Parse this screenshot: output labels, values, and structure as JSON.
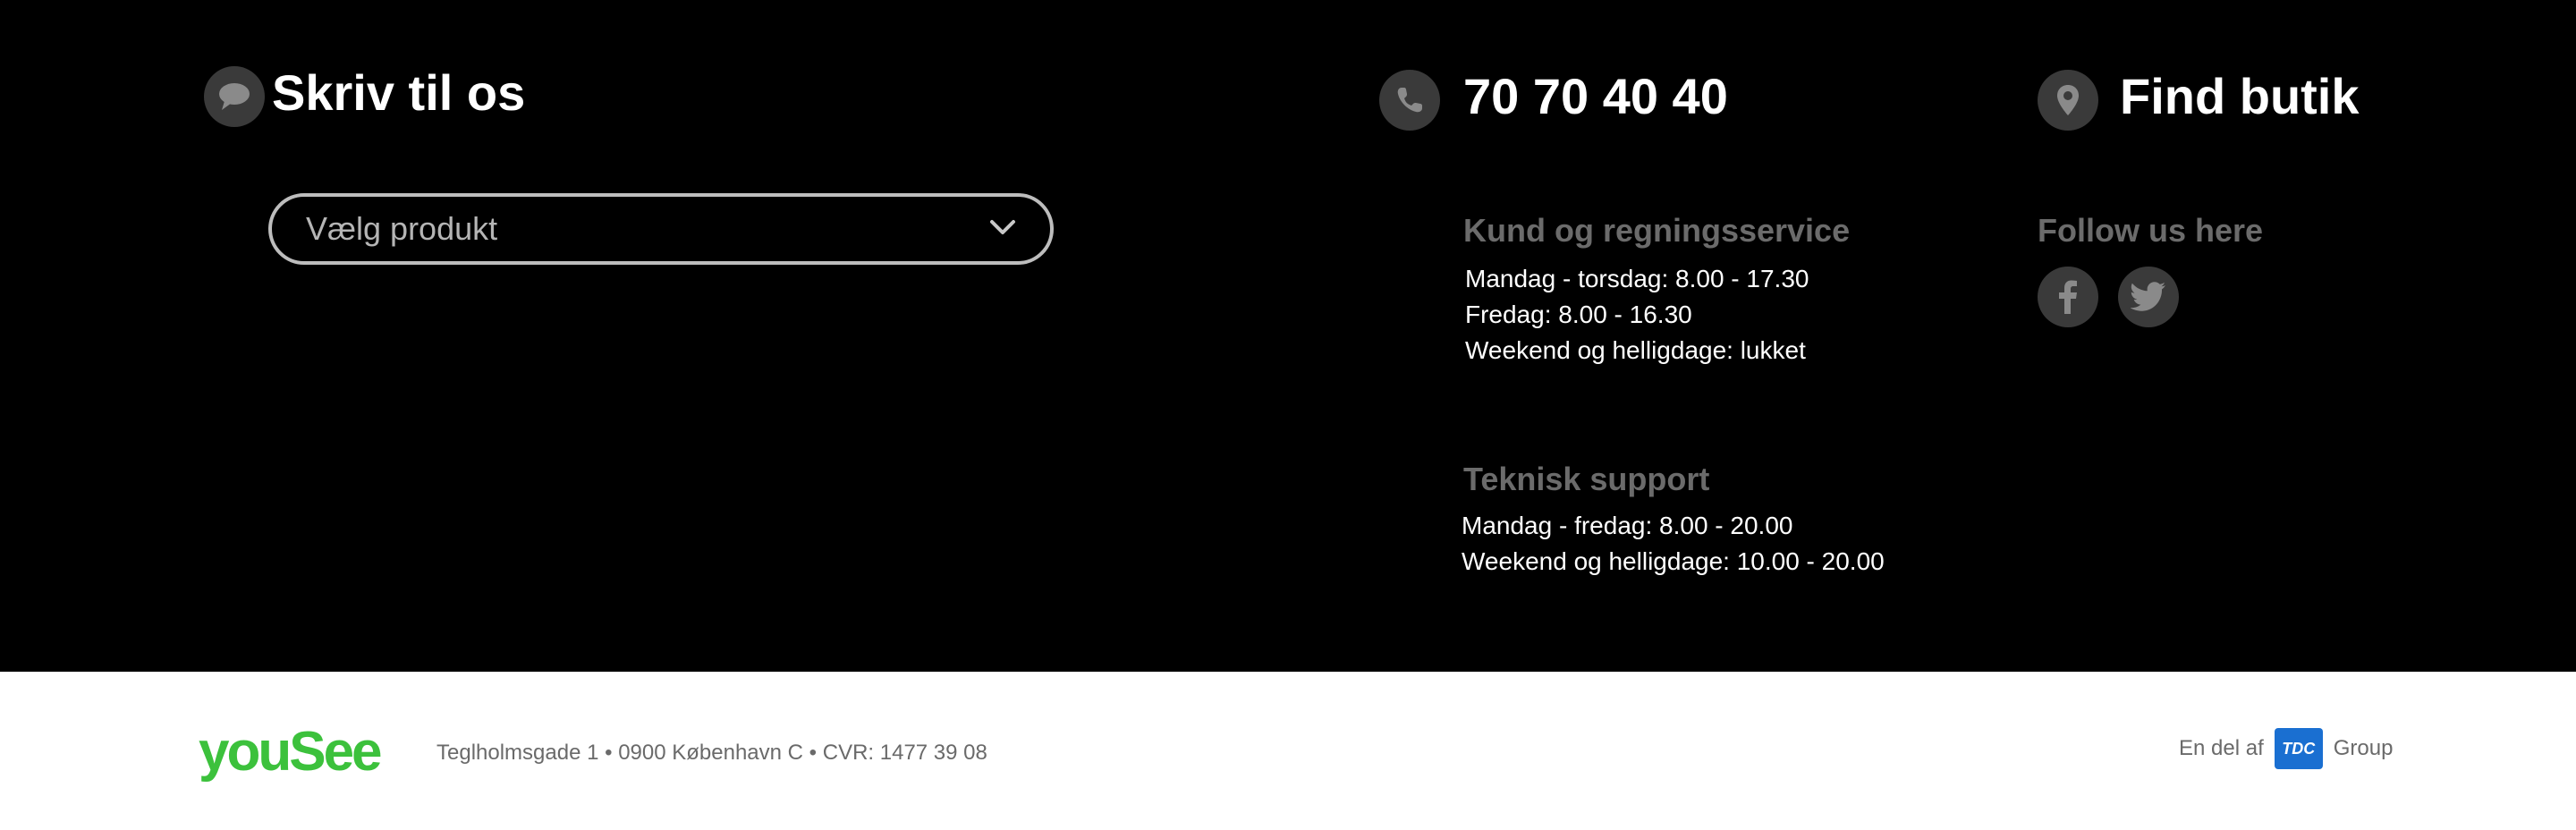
{
  "contact_form": {
    "heading": "Skriv til os",
    "select_placeholder": "Vælg produkt"
  },
  "phone": {
    "number": "70 70 40 40",
    "customer_service": {
      "title": "Kund og regningsservice",
      "hours": [
        "Mandag - torsdag: 8.00 - 17.30",
        "Fredag: 8.00 - 16.30",
        "Weekend og helligdage: lukket"
      ]
    },
    "tech_support": {
      "title": "Teknisk support",
      "hours": [
        "Mandag - fredag: 8.00 - 20.00",
        "Weekend og helligdage: 10.00 - 20.00"
      ]
    }
  },
  "store": {
    "heading": "Find butik",
    "follow_title": "Follow us here",
    "social_icons": [
      "facebook-icon",
      "twitter-icon"
    ]
  },
  "footer": {
    "logo": "youSee",
    "address": "Teglholmsgade 1 • 0900 København C • CVR: 1477 39 08",
    "group_prefix": "En del af",
    "group_logo": "TDC",
    "group_suffix": "Group"
  },
  "colors": {
    "background_top": "#000000",
    "background_bottom": "#ffffff",
    "brand_green": "#3cc13c",
    "icon_circle": "#3a3a3a",
    "tdc_blue": "#1a6fd1"
  }
}
